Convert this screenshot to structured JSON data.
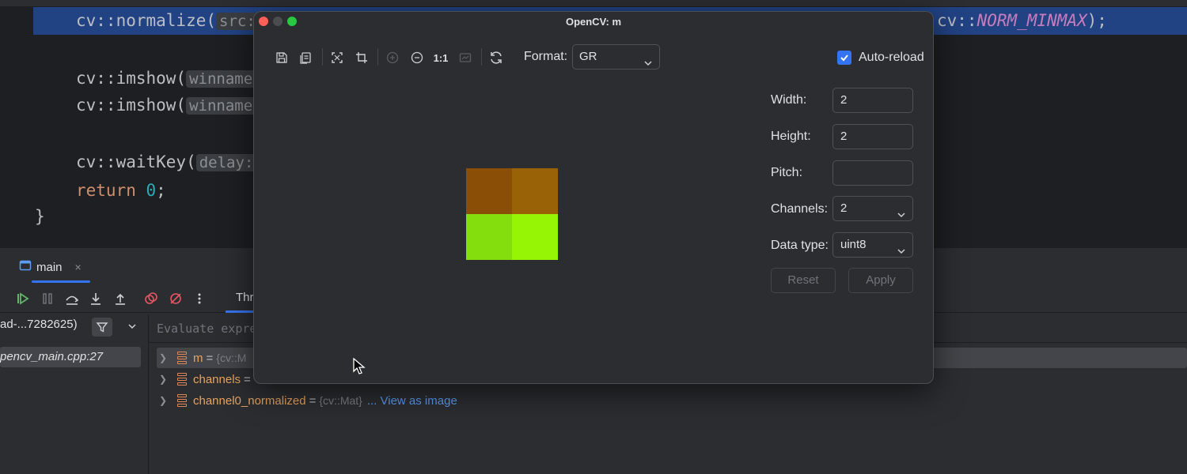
{
  "editor": {
    "line1_func": "cv::normalize(",
    "line1_hint": "src:",
    "line1_tail_ns": "cv::",
    "line1_tail_enum": "NORM_MINMAX",
    "line1_tail_end": ");",
    "line2_func": "cv::imshow(",
    "line2_hint": "winname",
    "line3_func": "cv::imshow(",
    "line3_hint": "winname",
    "line4_func": "cv::waitKey(",
    "line4_hint": "delay:",
    "line5_kw": "return",
    "line5_num": "0",
    "line5_end": ";",
    "closing_brace": "}"
  },
  "debug": {
    "tab_label": "main",
    "tab_close": "×",
    "threads_label": "Thr",
    "thread_select": "ad-...7282625)",
    "frame": "pencv_main.cpp:27",
    "eval_placeholder": "Evaluate expre",
    "variables": [
      {
        "name": "m",
        "eq": "=",
        "type": "{cv::M"
      },
      {
        "name": "channels",
        "eq": "="
      },
      {
        "name": "channel0_normalized",
        "eq": "=",
        "type": "{cv::Mat}",
        "link": "... View as image"
      }
    ]
  },
  "dialog": {
    "title": "OpenCV: m",
    "one_to_one": "1:1",
    "format_label": "Format:",
    "format_value": "GR",
    "auto_reload_label": "Auto-reload",
    "auto_reload_checked": true,
    "fields": {
      "width_label": "Width:",
      "width_value": "2",
      "height_label": "Height:",
      "height_value": "2",
      "pitch_label": "Pitch:",
      "pitch_value": "",
      "channels_label": "Channels:",
      "channels_value": "2",
      "datatype_label": "Data type:",
      "datatype_value": "uint8"
    },
    "reset_label": "Reset",
    "apply_label": "Apply",
    "pixels": [
      [
        "#8a4e06",
        "#9a6206"
      ],
      [
        "#84dd0c",
        "#96f505"
      ]
    ]
  },
  "colors": {
    "accent": "#3574f0",
    "highlight_line": "#214283"
  }
}
